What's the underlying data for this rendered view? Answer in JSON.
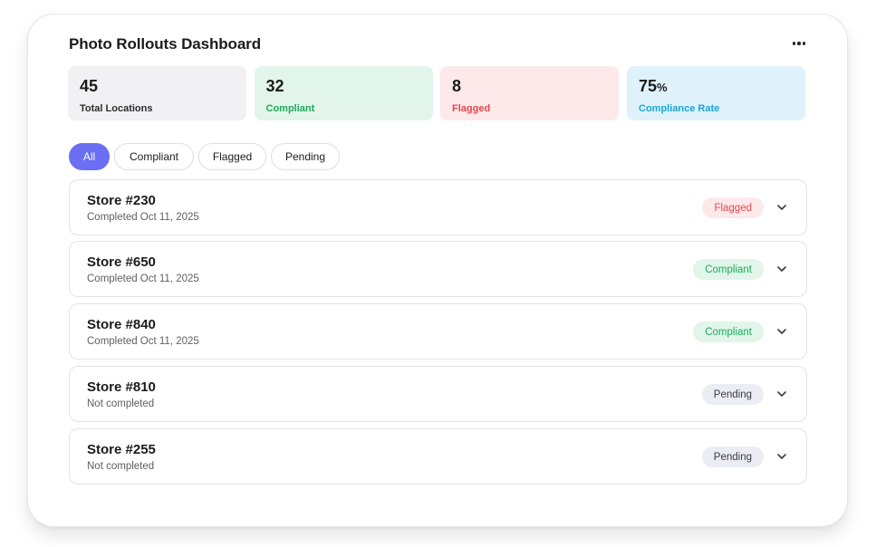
{
  "dashboard": {
    "title": "Photo Rollouts Dashboard",
    "menu_icon": "more-horizontal-icon"
  },
  "stats": [
    {
      "value": "45",
      "unit": "",
      "label": "Total Locations",
      "bg": "#f1f1f3",
      "label_color": "#2c2c31"
    },
    {
      "value": "32",
      "unit": "",
      "label": "Compliant",
      "bg": "#e1f5ea",
      "label_color": "#1eaa5c"
    },
    {
      "value": "8",
      "unit": "",
      "label": "Flagged",
      "bg": "#fde8ea",
      "label_color": "#e5484d"
    },
    {
      "value": "75",
      "unit": "%",
      "label": "Compliance Rate",
      "bg": "#dff2fb",
      "label_color": "#16a6d6"
    }
  ],
  "filters": [
    {
      "label": "All",
      "active": true
    },
    {
      "label": "Compliant",
      "active": false
    },
    {
      "label": "Flagged",
      "active": false
    },
    {
      "label": "Pending",
      "active": false
    }
  ],
  "stores": [
    {
      "name": "Store #230",
      "status_text": "Completed Oct 11, 2025",
      "badge": "Flagged",
      "badge_bg": "#fde8ea",
      "badge_color": "#e5484d"
    },
    {
      "name": "Store #650",
      "status_text": "Completed Oct 11, 2025",
      "badge": "Compliant",
      "badge_bg": "#e1f5ea",
      "badge_color": "#1eaa5c"
    },
    {
      "name": "Store #840",
      "status_text": "Completed Oct 11, 2025",
      "badge": "Compliant",
      "badge_bg": "#e1f5ea",
      "badge_color": "#1eaa5c"
    },
    {
      "name": "Store #810",
      "status_text": "Not completed",
      "badge": "Pending",
      "badge_bg": "#ececf4",
      "badge_color": "#3a3a44"
    },
    {
      "name": "Store #255",
      "status_text": "Not completed",
      "badge": "Pending",
      "badge_bg": "#ececf4",
      "badge_color": "#3a3a44"
    }
  ],
  "chevron_icon": "chevron-down-icon"
}
